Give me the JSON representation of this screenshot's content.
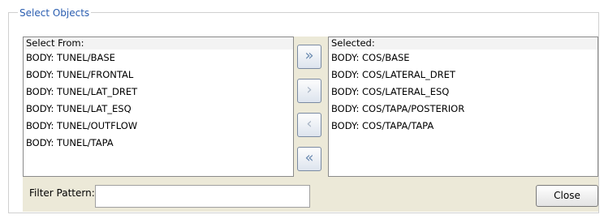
{
  "group": {
    "title": "Select Objects"
  },
  "select_from": {
    "header": "Select From:",
    "items": [
      "BODY: TUNEL/BASE",
      "BODY: TUNEL/FRONTAL",
      "BODY: TUNEL/LAT_DRET",
      "BODY: TUNEL/LAT_ESQ",
      "BODY: TUNEL/OUTFLOW",
      "BODY: TUNEL/TAPA"
    ]
  },
  "selected": {
    "header": "Selected:",
    "items": [
      "BODY: COS/BASE",
      "BODY: COS/LATERAL_DRET",
      "BODY: COS/LATERAL_ESQ",
      "BODY: COS/TAPA/POSTERIOR",
      "BODY: COS/TAPA/TAPA"
    ]
  },
  "buttons": {
    "add_all": "»",
    "add": "›",
    "remove": "‹",
    "remove_all": "«",
    "add_all_icon": "double-chevron-right-icon",
    "add_icon": "chevron-right-icon",
    "remove_icon": "chevron-left-icon",
    "remove_all_icon": "double-chevron-left-icon"
  },
  "filter": {
    "label": "Filter Pattern:",
    "value": ""
  },
  "close": {
    "label": "Close"
  },
  "colors": {
    "title": "#2a5db0",
    "panel_bg": "#ece9d8",
    "arrow": "#6a8ab0"
  }
}
